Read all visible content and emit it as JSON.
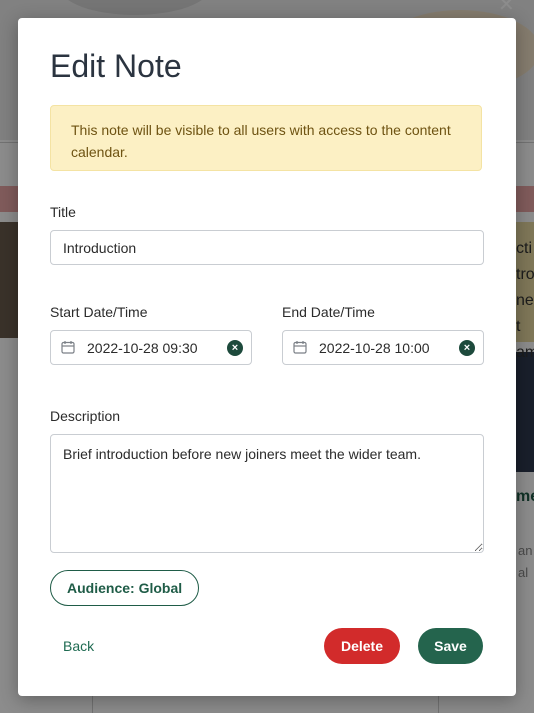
{
  "modal": {
    "title": "Edit Note",
    "notice": "This note will be visible to all users with access to the content calendar.",
    "title_field": {
      "label": "Title",
      "value": "Introduction"
    },
    "start": {
      "label": "Start Date/Time",
      "value": "2022-10-28 09:30",
      "icon": "calendar-icon",
      "clear_icon": "clear-icon"
    },
    "end": {
      "label": "End Date/Time",
      "value": "2022-10-28 10:00",
      "icon": "calendar-icon",
      "clear_icon": "clear-icon"
    },
    "description": {
      "label": "Description",
      "value": "Brief introduction before new joiners meet the wider team."
    },
    "audience_label": "Audience: Global",
    "back_label": "Back",
    "delete_label": "Delete",
    "save_label": "Save"
  },
  "background": {
    "right_text_lines": [
      "cti",
      "tro",
      "ne t",
      "am"
    ],
    "right_green": "me",
    "right_grey_lines": [
      "an",
      "al"
    ]
  },
  "colors": {
    "accent": "#24644d",
    "danger": "#d22b2b",
    "notice_bg": "#fcf0c4",
    "notice_text": "#6e5312"
  }
}
